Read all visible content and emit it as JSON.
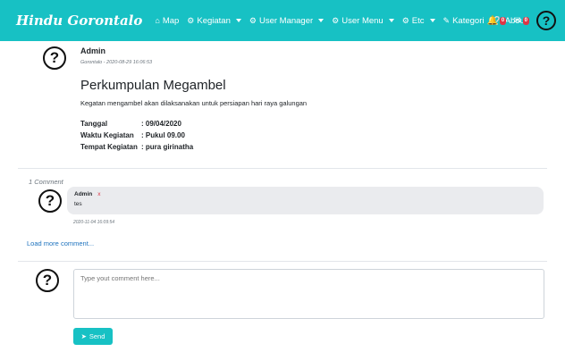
{
  "nav": {
    "brand": "Hindu Gorontalo",
    "items": [
      {
        "label": "Map",
        "icon": "home-icon",
        "dropdown": false
      },
      {
        "label": "Kegiatan",
        "icon": "gear-icon",
        "dropdown": true
      },
      {
        "label": "User Manager",
        "icon": "gear-icon",
        "dropdown": true
      },
      {
        "label": "User Menu",
        "icon": "gear-icon",
        "dropdown": true
      },
      {
        "label": "Etc",
        "icon": "gear-icon",
        "dropdown": true
      },
      {
        "label": "Kategori",
        "icon": "edit-icon",
        "dropdown": false
      },
      {
        "label": "About",
        "icon": "question-circle-icon",
        "dropdown": false
      }
    ],
    "notif_count": "0",
    "mail_count": "0",
    "avatar_glyph": "?"
  },
  "post": {
    "author": "Admin",
    "date": "Gorontalo - 2020-08-29 16:06:53",
    "title": "Perkumpulan Megambel",
    "description": "Kegatan mengambel akan dilaksanakan untuk persiapan hari raya galungan",
    "meta": [
      {
        "key": "Tanggal",
        "value": ": 09/04/2020"
      },
      {
        "key": "Waktu Kegiatan",
        "value": ": Pukul 09.00"
      },
      {
        "key": "Tempat Kegiatan",
        "value": ": pura girinatha"
      }
    ]
  },
  "comments": {
    "count_label": "1 Comment",
    "items": [
      {
        "author": "Admin",
        "delete_label": "x",
        "text": "tes",
        "date": "2020-11-04 16:09:54"
      }
    ],
    "load_more": "Load more comment..."
  },
  "form": {
    "placeholder": "Type yout comment here...",
    "value": "",
    "send_label": "Send"
  },
  "colors": {
    "accent": "#17c1c4",
    "badge": "#dc3545",
    "link": "#1e73be"
  }
}
